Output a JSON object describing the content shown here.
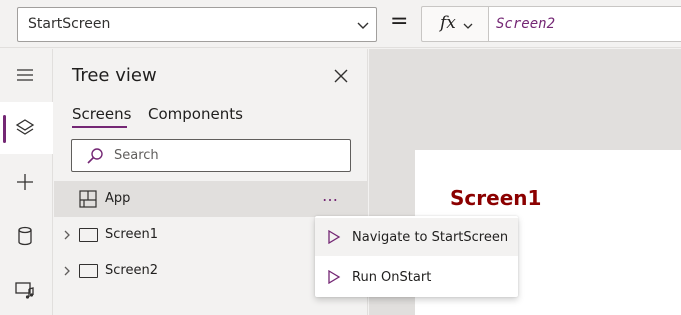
{
  "formula_bar": {
    "property": "StartScreen",
    "equals": "=",
    "fx_label": "fx",
    "formula": "Screen2"
  },
  "rail": {
    "items": [
      {
        "icon": "hamburger-icon",
        "active": false
      },
      {
        "icon": "layers-icon",
        "active": true
      },
      {
        "icon": "plus-icon",
        "active": false
      },
      {
        "icon": "database-icon",
        "active": false
      },
      {
        "icon": "media-icon",
        "active": false
      }
    ]
  },
  "tree": {
    "title": "Tree view",
    "tabs": [
      "Screens",
      "Components"
    ],
    "active_tab": "Screens",
    "search_placeholder": "Search",
    "items": [
      {
        "label": "App",
        "selected": true
      },
      {
        "label": "Screen1",
        "selected": false
      },
      {
        "label": "Screen2",
        "selected": false
      }
    ],
    "more_label": "…"
  },
  "context_menu": {
    "items": [
      {
        "label": "Navigate to StartScreen"
      },
      {
        "label": "Run OnStart"
      }
    ]
  },
  "canvas": {
    "screen_title": "Screen1"
  },
  "colors": {
    "accent": "#742774",
    "screen_title": "#8b0000"
  }
}
